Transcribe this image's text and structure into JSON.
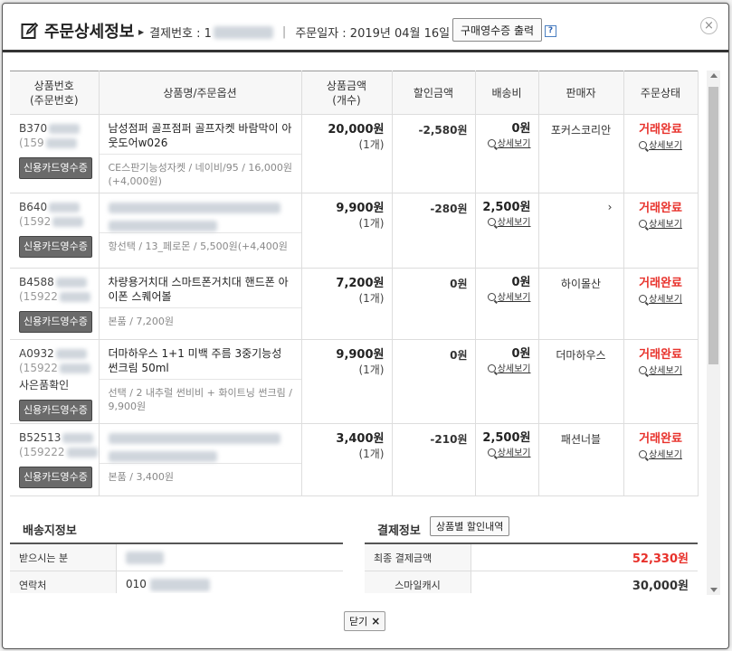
{
  "header": {
    "title": "주문상세정보",
    "payment_label": "결제번호 : 1",
    "order_date_label": "주문일자 : 2019년 04월 16일",
    "receipt_button": "구매영수증 출력",
    "help_label": "?",
    "close_label": "×"
  },
  "table": {
    "headers": [
      "상품번호\n(주문번호)",
      "상품명/주문옵션",
      "상품금액\n(개수)",
      "할인금액",
      "배송비",
      "판매자",
      "주문상태"
    ],
    "rows": [
      {
        "id": "B370",
        "sub": "(159",
        "gift": "",
        "receipt": "신용카드영수증",
        "name": "남성점퍼 골프점퍼 골프자켓 바람막이 아웃도어w026",
        "option": "CE스판기능성자켓 / 네이비/95 / 16,000원(+4,000원)",
        "price": "20,000원",
        "qty": "(1개)",
        "discount": "-2,580원",
        "shipping": "0원",
        "detail": "상세보기",
        "seller": "포커스코리안",
        "status": "거래완료",
        "status_detail": "상세보기"
      },
      {
        "id": "B640",
        "sub": "(1592",
        "gift": "",
        "receipt": "신용카드영수증",
        "name": "",
        "option": "항선택 / 13_페로몬 / 5,500원(+4,400원",
        "price": "9,900원",
        "qty": "(1개)",
        "discount": "-280원",
        "shipping": "2,500원",
        "detail": "상세보기",
        "seller": "",
        "status": "거래완료",
        "status_detail": "상세보기"
      },
      {
        "id": "B4588",
        "sub": "(15922",
        "gift": "",
        "receipt": "신용카드영수증",
        "name": "차량용거치대 스마트폰거치대 핸드폰 아이폰 스퀘어볼",
        "option": "본품 / 7,200원",
        "price": "7,200원",
        "qty": "(1개)",
        "discount": "0원",
        "shipping": "0원",
        "detail": "상세보기",
        "seller": "하이몰산",
        "status": "거래완료",
        "status_detail": "상세보기"
      },
      {
        "id": "A0932",
        "sub": "(15922",
        "gift": "사은품확인",
        "receipt": "신용카드영수증",
        "name": "더마하우스 1+1 미백 주름 3중기능성 썬크림 50ml",
        "option": "선택 / 2 내추럴 썬비비 + 화이트닝 썬크림 / 9,900원",
        "price": "9,900원",
        "qty": "(1개)",
        "discount": "0원",
        "shipping": "0원",
        "detail": "상세보기",
        "seller": "더마하우스",
        "status": "거래완료",
        "status_detail": "상세보기"
      },
      {
        "id": "B52513",
        "sub": "(159222",
        "gift": "",
        "receipt": "신용카드영수증",
        "name": "",
        "option": "본품 / 3,400원",
        "price": "3,400원",
        "qty": "(1개)",
        "discount": "-210원",
        "shipping": "2,500원",
        "detail": "상세보기",
        "seller": "패션너블",
        "status": "거래완료",
        "status_detail": "상세보기"
      }
    ]
  },
  "shipping_info": {
    "title": "배송지정보",
    "recipient_label": "받으시는 분",
    "contact_label": "연락처",
    "contact_value": "010"
  },
  "payment_info": {
    "title": "결제정보",
    "discount_button": "상품별 할인내역",
    "total_label": "최종 결제금액",
    "total_value": "52,330원",
    "cash_label": "스마일캐시",
    "cash_value": "30,000원"
  },
  "footer": {
    "close_label": "닫기",
    "close_icon": "×"
  },
  "colors": {
    "status_red": "#e8312b",
    "header_border": "#333333",
    "button_dark": "#6a6a6a"
  }
}
